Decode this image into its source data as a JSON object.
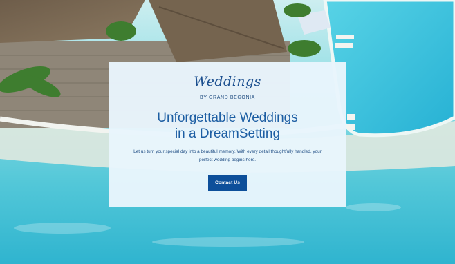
{
  "hero": {
    "logo": "Weddings",
    "logo_subtitle": "BY GRAND BEGONIA",
    "headline_line1": "Unforgettable Weddings",
    "headline_line2": "in a DreamSetting",
    "body_line1": "Let us turn your special day into a beautiful memory. With every detail thoughtfully handled, your",
    "body_line2": "perfect wedding begins here.",
    "cta_label": "Contact Us"
  },
  "colors": {
    "card_background": "#e8f5fc",
    "headline": "#1d5ea3",
    "cta_background": "#0d4f9a",
    "lagoon": "#5ccad6",
    "pool": "#3cc2db"
  }
}
